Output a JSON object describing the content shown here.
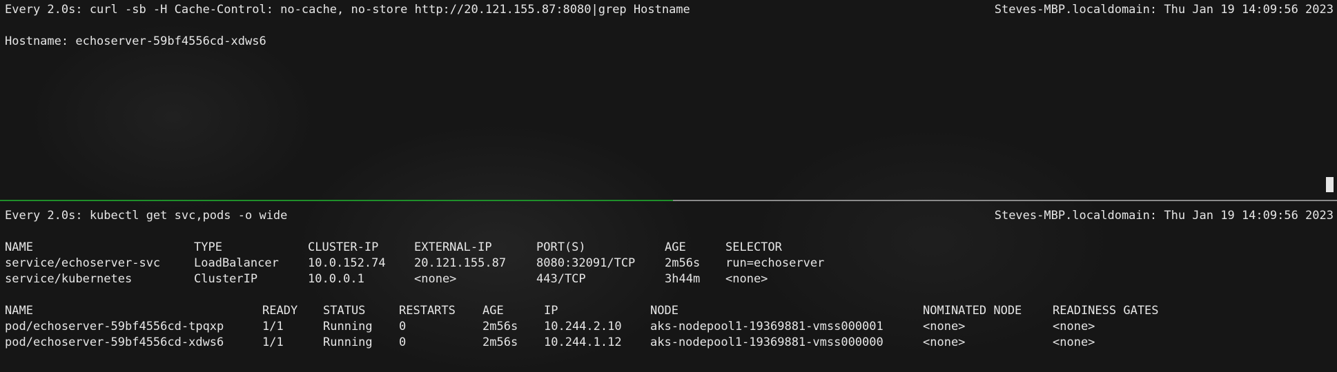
{
  "top_pane": {
    "header": "Every 2.0s: curl -sb -H Cache-Control: no-cache, no-store http://20.121.155.87:8080|grep Hostname",
    "host_time": "Steves-MBP.localdomain: Thu Jan 19 14:09:56 2023",
    "output": "Hostname: echoserver-59bf4556cd-xdws6"
  },
  "bottom_pane": {
    "header": "Every 2.0s: kubectl get svc,pods -o wide",
    "host_time": "Steves-MBP.localdomain: Thu Jan 19 14:09:56 2023",
    "services": {
      "columns": [
        "NAME",
        "TYPE",
        "CLUSTER-IP",
        "EXTERNAL-IP",
        "PORT(S)",
        "AGE",
        "SELECTOR"
      ],
      "rows": [
        [
          "service/echoserver-svc",
          "LoadBalancer",
          "10.0.152.74",
          "20.121.155.87",
          "8080:32091/TCP",
          "2m56s",
          "run=echoserver"
        ],
        [
          "service/kubernetes",
          "ClusterIP",
          "10.0.0.1",
          "<none>",
          "443/TCP",
          "3h44m",
          "<none>"
        ]
      ]
    },
    "pods": {
      "columns": [
        "NAME",
        "READY",
        "STATUS",
        "RESTARTS",
        "AGE",
        "IP",
        "NODE",
        "NOMINATED NODE",
        "READINESS GATES"
      ],
      "rows": [
        [
          "pod/echoserver-59bf4556cd-tpqxp",
          "1/1",
          "Running",
          "0",
          "2m56s",
          "10.244.2.10",
          "aks-nodepool1-19369881-vmss000001",
          "<none>",
          "<none>"
        ],
        [
          "pod/echoserver-59bf4556cd-xdws6",
          "1/1",
          "Running",
          "0",
          "2m56s",
          "10.244.1.12",
          "aks-nodepool1-19369881-vmss000000",
          "<none>",
          "<none>"
        ]
      ]
    }
  },
  "colors": {
    "text": "#e6e6e6",
    "background": "#161616",
    "active_divider": "#1f8f2a",
    "divider": "#8a8a8a"
  }
}
